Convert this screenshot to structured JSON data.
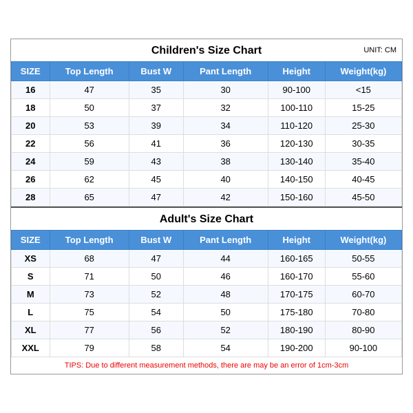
{
  "children": {
    "title": "Children's Size Chart",
    "unit": "UNIT: CM",
    "headers": [
      "SIZE",
      "Top Length",
      "Bust W",
      "Pant Length",
      "Height",
      "Weight(kg)"
    ],
    "rows": [
      [
        "16",
        "47",
        "35",
        "30",
        "90-100",
        "<15"
      ],
      [
        "18",
        "50",
        "37",
        "32",
        "100-110",
        "15-25"
      ],
      [
        "20",
        "53",
        "39",
        "34",
        "110-120",
        "25-30"
      ],
      [
        "22",
        "56",
        "41",
        "36",
        "120-130",
        "30-35"
      ],
      [
        "24",
        "59",
        "43",
        "38",
        "130-140",
        "35-40"
      ],
      [
        "26",
        "62",
        "45",
        "40",
        "140-150",
        "40-45"
      ],
      [
        "28",
        "65",
        "47",
        "42",
        "150-160",
        "45-50"
      ]
    ]
  },
  "adults": {
    "title": "Adult's Size Chart",
    "headers": [
      "SIZE",
      "Top Length",
      "Bust W",
      "Pant Length",
      "Height",
      "Weight(kg)"
    ],
    "rows": [
      [
        "XS",
        "68",
        "47",
        "44",
        "160-165",
        "50-55"
      ],
      [
        "S",
        "71",
        "50",
        "46",
        "160-170",
        "55-60"
      ],
      [
        "M",
        "73",
        "52",
        "48",
        "170-175",
        "60-70"
      ],
      [
        "L",
        "75",
        "54",
        "50",
        "175-180",
        "70-80"
      ],
      [
        "XL",
        "77",
        "56",
        "52",
        "180-190",
        "80-90"
      ],
      [
        "XXL",
        "79",
        "58",
        "54",
        "190-200",
        "90-100"
      ]
    ]
  },
  "tips": "TIPS: Due to different measurement methods, there are may be an error of 1cm-3cm"
}
